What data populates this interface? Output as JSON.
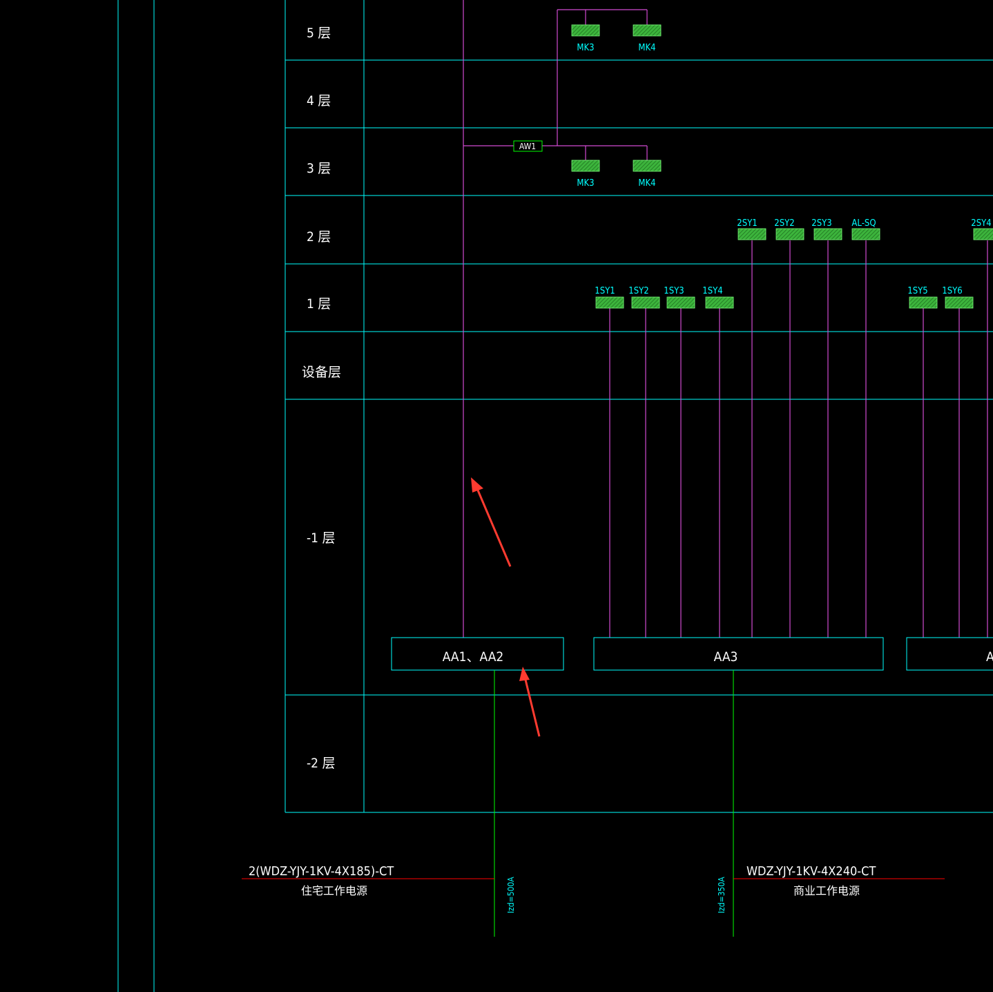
{
  "floors": [
    {
      "id": "f5",
      "label": "5 层"
    },
    {
      "id": "f4",
      "label": "4 层"
    },
    {
      "id": "f3",
      "label": "3 层"
    },
    {
      "id": "f2",
      "label": "2 层"
    },
    {
      "id": "f1",
      "label": "1 层"
    },
    {
      "id": "fe",
      "label": "设备层"
    },
    {
      "id": "fm1",
      "label": "-1 层"
    },
    {
      "id": "fm2",
      "label": "-2 层"
    }
  ],
  "panels": {
    "mk3_top": "MK3",
    "mk4_top": "MK4",
    "mk3_bottom": "MK3",
    "mk4_bottom": "MK4",
    "aw1": "AW1",
    "sy2_1": "2SY1",
    "sy2_2": "2SY2",
    "sy2_3": "2SY3",
    "al_sq": "AL-SQ",
    "sy2_4": "2SY4",
    "sy1_1": "1SY1",
    "sy1_2": "1SY2",
    "sy1_3": "1SY3",
    "sy1_4": "1SY4",
    "sy1_5": "1SY5",
    "sy1_6": "1SY6"
  },
  "switchgear": {
    "aa12": "AA1、AA2",
    "aa3": "AA3",
    "aa_partial": "A"
  },
  "feeders": {
    "residential_cable": "2(WDZ-YJY-1KV-4X185)-CT",
    "residential_note": "住宅工作电源",
    "residential_izd": "Izd=500A",
    "commercial_cable": "WDZ-YJY-1KV-4X240-CT",
    "commercial_note": "商业工作电源",
    "commercial_izd": "Izd=350A"
  },
  "colors": {
    "grid": "#00ffff",
    "riser": "#d24bd2",
    "feeder": "#00ff00",
    "cable": "#ff0000",
    "panel_fill": "#3cb43c",
    "arrow": "#ff3b30"
  }
}
